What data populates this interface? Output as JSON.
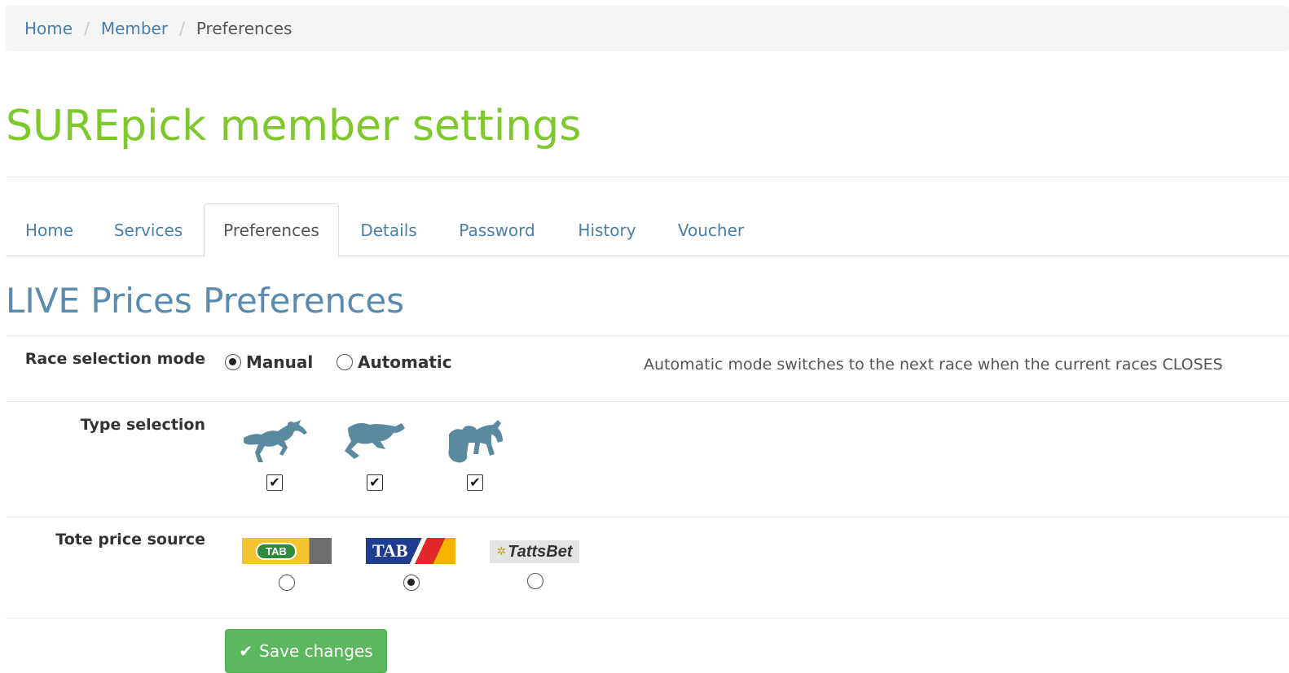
{
  "breadcrumb": {
    "items": [
      "Home",
      "Member"
    ],
    "separator": "/",
    "current": "Preferences"
  },
  "page_title": "SUREpick member settings",
  "tabs": [
    {
      "label": "Home",
      "active": false
    },
    {
      "label": "Services",
      "active": false
    },
    {
      "label": "Preferences",
      "active": true
    },
    {
      "label": "Details",
      "active": false
    },
    {
      "label": "Password",
      "active": false
    },
    {
      "label": "History",
      "active": false
    },
    {
      "label": "Voucher",
      "active": false
    }
  ],
  "section_title": "LIVE Prices Preferences",
  "race_selection": {
    "label": "Race selection mode",
    "options": [
      {
        "label": "Manual",
        "checked": true
      },
      {
        "label": "Automatic",
        "checked": false
      }
    ],
    "hint": "Automatic mode switches to the next race when the current races CLOSES"
  },
  "type_selection": {
    "label": "Type selection",
    "types": [
      {
        "icon": "thoroughbred-horse-icon",
        "checked": true
      },
      {
        "icon": "greyhound-icon",
        "checked": true
      },
      {
        "icon": "harness-trotter-icon",
        "checked": true
      }
    ]
  },
  "tote_source": {
    "label": "Tote price source",
    "sources": [
      {
        "logo_text": "TAB",
        "icon": "tab-green-logo",
        "checked": false
      },
      {
        "logo_text": "TAB",
        "icon": "tab-blue-logo",
        "checked": true
      },
      {
        "logo_text": "TattsBet",
        "icon": "tattsbet-logo",
        "checked": false
      }
    ]
  },
  "save_button": {
    "label": "Save changes",
    "icon": "check-icon"
  },
  "colors": {
    "accent_green": "#7ec82c",
    "link_blue": "#4a7fa8",
    "section_blue": "#5b8aaf",
    "icon_blue": "#5b8aa0",
    "button_green": "#5cb85c"
  }
}
